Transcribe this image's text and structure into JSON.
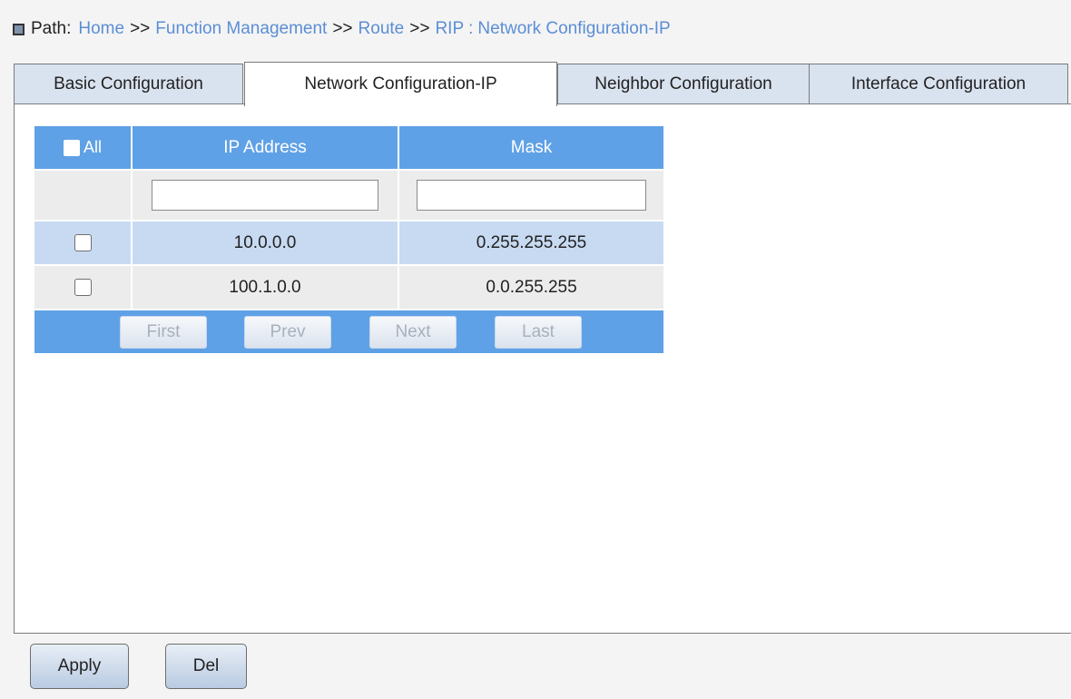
{
  "breadcrumb": {
    "label": "Path:",
    "items": [
      "Home",
      "Function Management",
      "Route",
      "RIP"
    ],
    "separator": ">>",
    "colon": ":",
    "current": "Network Configuration-IP"
  },
  "tabs": [
    {
      "label": "Basic Configuration",
      "active": false
    },
    {
      "label": "Network Configuration-IP",
      "active": true
    },
    {
      "label": "Neighbor Configuration",
      "active": false
    },
    {
      "label": "Interface Configuration",
      "active": false
    }
  ],
  "table": {
    "select_all_label": "All",
    "columns": [
      "IP Address",
      "Mask"
    ],
    "filter": {
      "ip_value": "",
      "mask_value": ""
    },
    "rows": [
      {
        "ip": "10.0.0.0",
        "mask": "0.255.255.255",
        "checked": false
      },
      {
        "ip": "100.1.0.0",
        "mask": "0.0.255.255",
        "checked": false
      }
    ],
    "pagination": {
      "first": "First",
      "prev": "Prev",
      "next": "Next",
      "last": "Last"
    }
  },
  "actions": {
    "apply": "Apply",
    "del": "Del"
  },
  "colors": {
    "header_blue": "#5fa1e6",
    "row_highlight": "#c7daf2",
    "link_blue": "#5b8ed6"
  }
}
